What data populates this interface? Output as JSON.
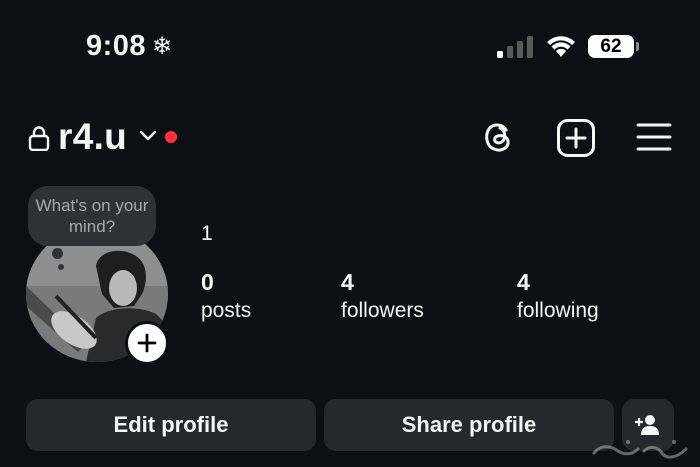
{
  "status_bar": {
    "time": "9:08",
    "time_icon": "snowflake-icon",
    "battery": "62"
  },
  "header": {
    "username": "r4.u",
    "icons": [
      "lock-icon",
      "chevron-down-icon",
      "notification-dot",
      "threads-icon",
      "create-icon",
      "menu-icon"
    ],
    "accent_dot_color": "#ff3040"
  },
  "profile": {
    "note_placeholder": "What's on your mind?",
    "name_line": "1",
    "stats": [
      {
        "value": "0",
        "label": "posts"
      },
      {
        "value": "4",
        "label": "followers"
      },
      {
        "value": "4",
        "label": "following"
      }
    ]
  },
  "actions": {
    "edit_label": "Edit profile",
    "share_label": "Share profile",
    "discover_icon": "add-person-icon"
  },
  "theme": {
    "background": "#0c1014",
    "button_bg": "#25292e",
    "bubble_bg": "#2e3236"
  }
}
